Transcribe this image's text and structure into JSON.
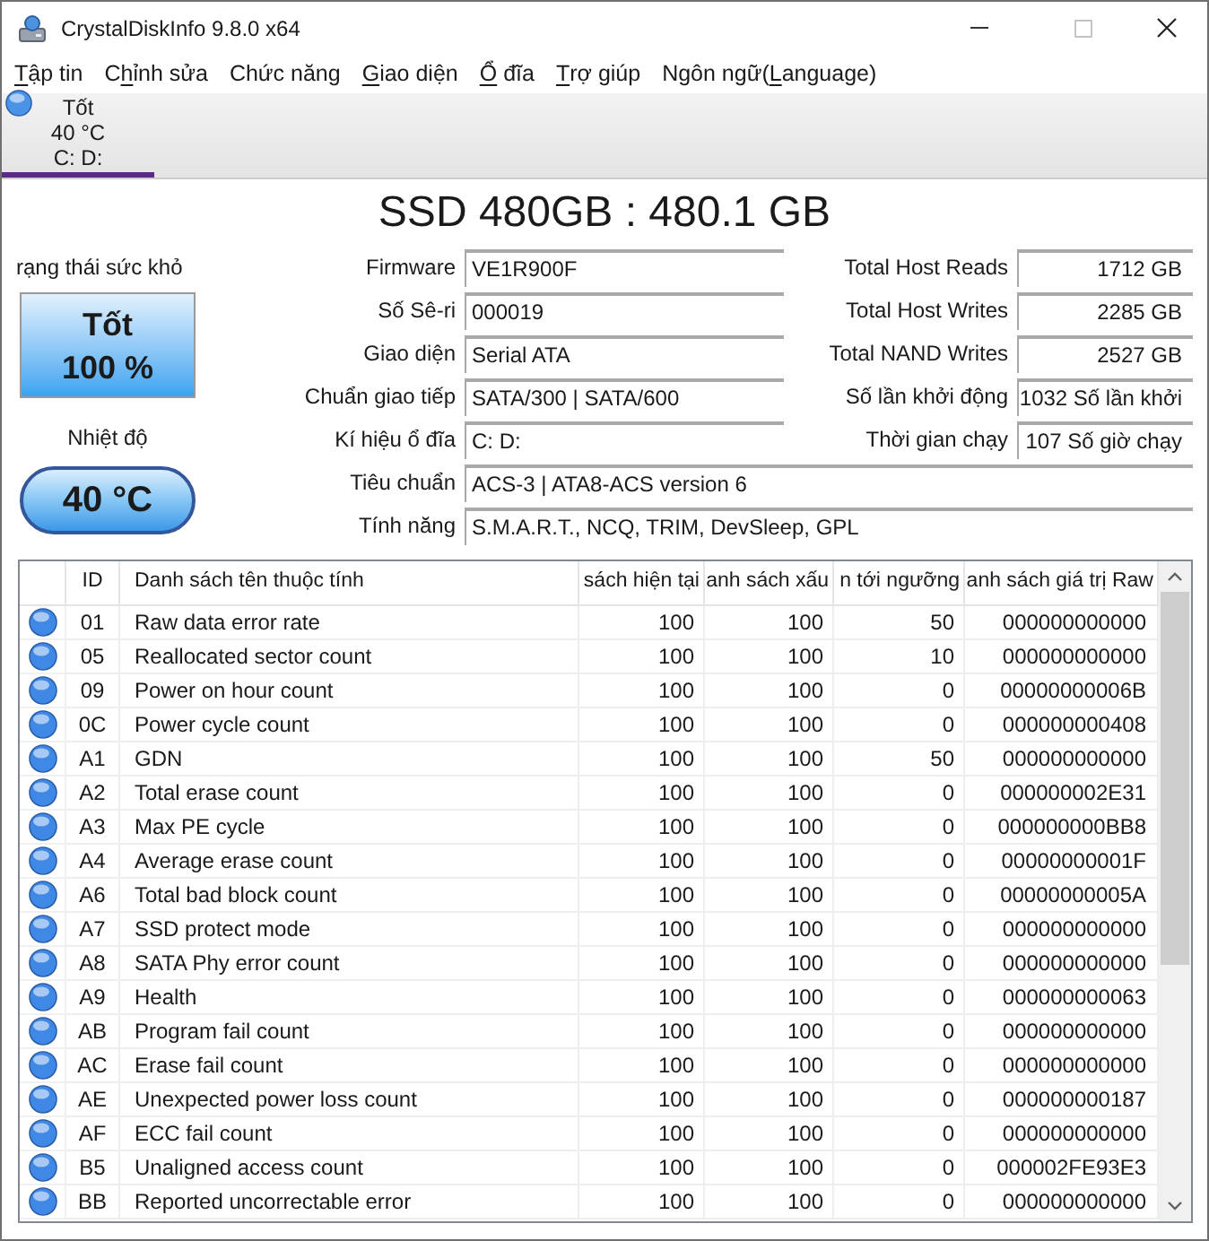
{
  "window": {
    "title": "CrystalDiskInfo 9.8.0 x64"
  },
  "menu": [
    {
      "access_key": "T",
      "after": "ập tin"
    },
    {
      "before": "C",
      "access_key": "h",
      "after": "ỉnh sửa"
    },
    {
      "before": "Chức năng"
    },
    {
      "access_key": "G",
      "after": "iao diện"
    },
    {
      "access_key": "Ổ",
      "after": " đĩa"
    },
    {
      "access_key": "T",
      "after": "rợ giúp"
    },
    {
      "before": "Ngôn ngữ(",
      "access_key": "L",
      "after": "anguage)"
    }
  ],
  "disk_tabs": [
    {
      "status": "Tốt",
      "temperature": "40 °C",
      "drives": "C: D:",
      "selected": true
    }
  ],
  "model": "SSD 480GB : 480.1 GB",
  "health": {
    "label": "rạng thái sức khỏ",
    "status": "Tốt",
    "percent": "100 %"
  },
  "temperature": {
    "label": "Nhiệt độ",
    "value": "40 °C"
  },
  "details": [
    {
      "label": "Firmware",
      "value": "VE1R900F"
    },
    {
      "label": "Số Sê-ri",
      "value": "000019"
    },
    {
      "label": "Giao diện",
      "value": "Serial ATA"
    },
    {
      "label": "Chuẩn giao tiếp",
      "value": "SATA/300 | SATA/600"
    },
    {
      "label": "Kí hiệu ổ đĩa",
      "value": "C: D:"
    }
  ],
  "counters": [
    {
      "label": "Total Host Reads",
      "value": "1712 GB"
    },
    {
      "label": "Total Host Writes",
      "value": "2285 GB"
    },
    {
      "label": "Total NAND Writes",
      "value": "2527 GB"
    },
    {
      "label": "Số lần khởi động",
      "value": "1032 Số lần khởi"
    },
    {
      "label": "Thời gian chạy",
      "value": "107 Số giờ chạy"
    }
  ],
  "details_wide": [
    {
      "label": "Tiêu chuẩn",
      "value": "ACS-3 | ATA8-ACS version 6"
    },
    {
      "label": "Tính năng",
      "value": "S.M.A.R.T., NCQ, TRIM, DevSleep, GPL"
    }
  ],
  "table": {
    "columns": [
      "ID",
      "Danh sách tên thuộc tính",
      "sách hiện tại",
      "anh sách xấu",
      "n tới ngưỡng",
      "anh sách giá trị Raw"
    ],
    "rows": [
      {
        "color": "#3f88e5",
        "cells": [
          "01",
          "Raw data error rate",
          "100",
          "100",
          "50",
          "000000000000"
        ]
      },
      {
        "color": "#3f88e5",
        "cells": [
          "05",
          "Reallocated sector count",
          "100",
          "100",
          "10",
          "000000000000"
        ]
      },
      {
        "color": "#3f88e5",
        "cells": [
          "09",
          "Power on hour count",
          "100",
          "100",
          "0",
          "00000000006B"
        ]
      },
      {
        "color": "#3f88e5",
        "cells": [
          "0C",
          "Power cycle count",
          "100",
          "100",
          "0",
          "000000000408"
        ]
      },
      {
        "color": "#3f88e5",
        "cells": [
          "A1",
          "GDN",
          "100",
          "100",
          "50",
          "000000000000"
        ]
      },
      {
        "color": "#3f88e5",
        "cells": [
          "A2",
          "Total erase count",
          "100",
          "100",
          "0",
          "000000002E31"
        ]
      },
      {
        "color": "#3f88e5",
        "cells": [
          "A3",
          "Max PE cycle",
          "100",
          "100",
          "0",
          "000000000BB8"
        ]
      },
      {
        "color": "#3f88e5",
        "cells": [
          "A4",
          "Average erase count",
          "100",
          "100",
          "0",
          "00000000001F"
        ]
      },
      {
        "color": "#3f88e5",
        "cells": [
          "A6",
          "Total bad block count",
          "100",
          "100",
          "0",
          "00000000005A"
        ]
      },
      {
        "color": "#3f88e5",
        "cells": [
          "A7",
          "SSD protect mode",
          "100",
          "100",
          "0",
          "000000000000"
        ]
      },
      {
        "color": "#3f88e5",
        "cells": [
          "A8",
          "SATA Phy error count",
          "100",
          "100",
          "0",
          "000000000000"
        ]
      },
      {
        "color": "#3f88e5",
        "cells": [
          "A9",
          "Health",
          "100",
          "100",
          "0",
          "000000000063"
        ]
      },
      {
        "color": "#3f88e5",
        "cells": [
          "AB",
          "Program fail count",
          "100",
          "100",
          "0",
          "000000000000"
        ]
      },
      {
        "color": "#3f88e5",
        "cells": [
          "AC",
          "Erase fail count",
          "100",
          "100",
          "0",
          "000000000000"
        ]
      },
      {
        "color": "#3f88e5",
        "cells": [
          "AE",
          "Unexpected power loss count",
          "100",
          "100",
          "0",
          "000000000187"
        ]
      },
      {
        "color": "#3f88e5",
        "cells": [
          "AF",
          "ECC fail count",
          "100",
          "100",
          "0",
          "000000000000"
        ]
      },
      {
        "color": "#3f88e5",
        "cells": [
          "B5",
          "Unaligned access count",
          "100",
          "100",
          "0",
          "000002FE93E3"
        ]
      },
      {
        "color": "#3f88e5",
        "cells": [
          "BB",
          "Reported uncorrectable error",
          "100",
          "100",
          "0",
          "000000000000"
        ]
      }
    ]
  }
}
